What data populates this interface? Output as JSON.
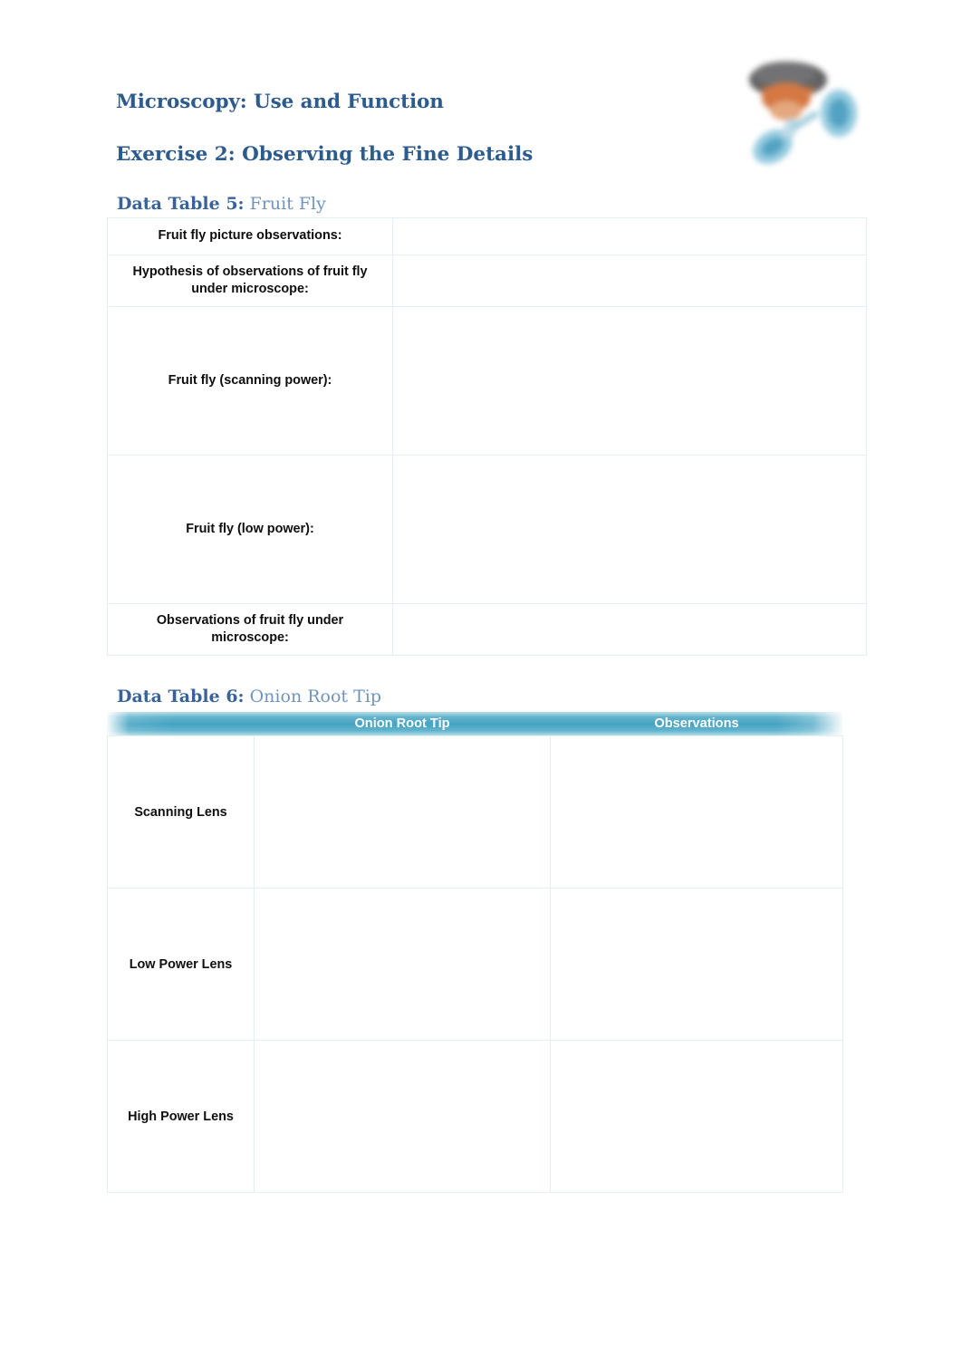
{
  "document": {
    "title": "Microscopy: Use and Function",
    "exercise": "Exercise 2: Observing the Fine Details"
  },
  "colors": {
    "heading_blue": "#2d5b8e",
    "caption_strong_blue": "#37639a",
    "caption_light_blue": "#6e94c0",
    "header_bar_teal": "#44a3c3",
    "table_border": "#e3eff0",
    "page_background": "#ffffff"
  },
  "table5": {
    "caption_label": "Data Table 5:",
    "caption_subject": "Fruit Fly",
    "rows": [
      {
        "label": "Fruit fly picture observations:",
        "value": "",
        "size": "r-short"
      },
      {
        "label": "Hypothesis of observations of fruit fly under microscope:",
        "value": "",
        "size": "r-two"
      },
      {
        "label": "Fruit fly (scanning power):",
        "value": "",
        "size": "r-tall"
      },
      {
        "label": "Fruit fly (low power):",
        "value": "",
        "size": "r-tall"
      },
      {
        "label": "Observations of fruit fly under microscope:",
        "value": "",
        "size": "r-two"
      }
    ]
  },
  "table6": {
    "caption_label": "Data Table 6:",
    "caption_subject": "Onion Root Tip",
    "headers": [
      "",
      "Onion Root Tip",
      "Observations"
    ],
    "rows": [
      {
        "label": "Scanning Lens",
        "onion_root_tip": "",
        "observations": ""
      },
      {
        "label": "Low Power Lens",
        "onion_root_tip": "",
        "observations": ""
      },
      {
        "label": "High Power Lens",
        "onion_root_tip": "",
        "observations": ""
      }
    ]
  },
  "decoration": {
    "icon": "microscope-illustration"
  }
}
